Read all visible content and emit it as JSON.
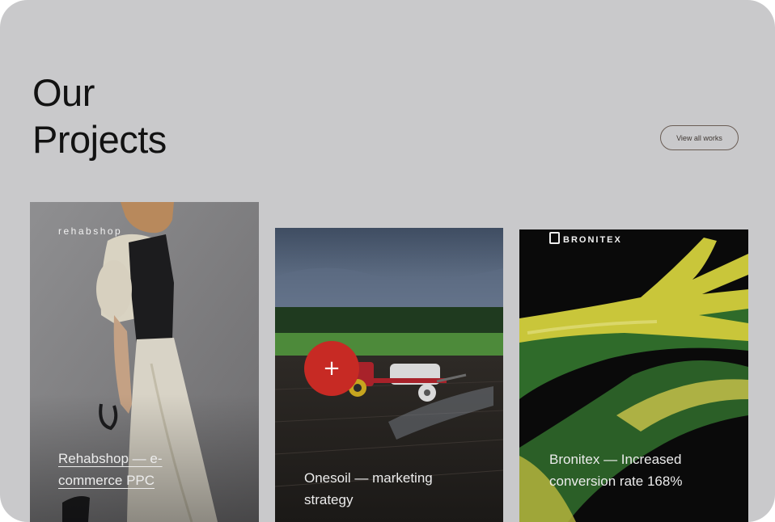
{
  "header": {
    "title_line1": "Our",
    "title_line2": "Projects",
    "view_all_label": "View all works"
  },
  "projects": [
    {
      "brand": "rehabshop",
      "caption_line1": "Rehabshop — e-",
      "caption_line2": "commerce PPC"
    },
    {
      "brand": "",
      "caption_line1": "Onesoil — marketing",
      "caption_line2": "strategy",
      "action_symbol": "+"
    },
    {
      "brand": "BRONITEX",
      "caption_line1": "Bronitex — Increased",
      "caption_line2": "conversion rate 168%"
    }
  ],
  "colors": {
    "page_background": "#c9c9cb",
    "title_text": "#121212",
    "accent_red": "#c72a24"
  }
}
